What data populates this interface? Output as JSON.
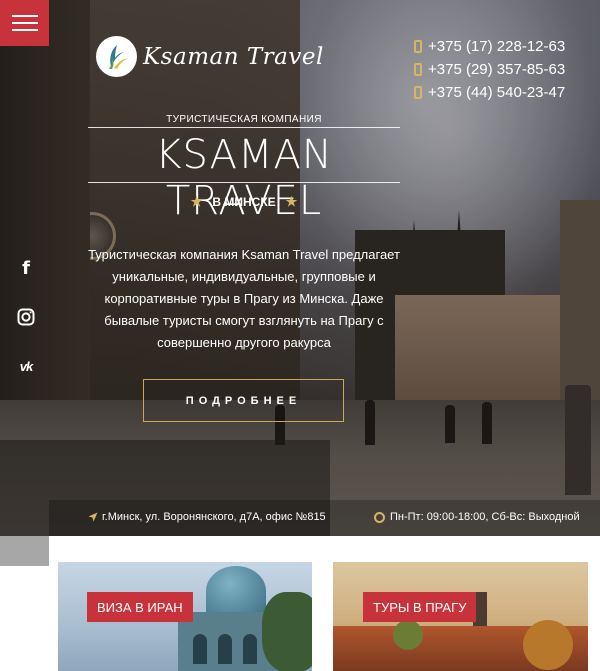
{
  "header": {
    "menu_icon": "hamburger-icon",
    "logo_text": "Ksaman Travel",
    "phones": [
      "+375 (17) 228-12-63",
      "+375 (29) 357-85-63",
      "+375 (44) 540-23-47"
    ]
  },
  "hero": {
    "subtitle": "ТУРИСТИЧЕСКАЯ КОМПАНИЯ",
    "title": "KSAMAN TRAVEL",
    "city": "В МИНСКЕ",
    "description": "Туристическая компания Ksaman Travel предлагает уникальные, индивидуальные, групповые и корпоративные туры в Прагу из Минска. Даже бывалые туристы смогут взглянуть на Прагу с совершенно другого ракурса",
    "more_button": "ПОДРОБНЕЕ"
  },
  "social": [
    {
      "name": "facebook",
      "glyph": "f"
    },
    {
      "name": "instagram",
      "glyph": "◎"
    },
    {
      "name": "vk",
      "glyph": "vk"
    }
  ],
  "footer_bar": {
    "address": "г.Минск, ул. Воронянского, д7А, офис №815",
    "hours": "Пн-Пт: 09:00-18:00, Сб-Вс: Выходной"
  },
  "cards": [
    {
      "label": "ВИЗА В ИРАН"
    },
    {
      "label": "ТУРЫ В ПРАГУ"
    }
  ],
  "colors": {
    "accent_red": "#c8323a",
    "accent_gold": "#d8b660",
    "grey_tab": "#a7a7a7"
  }
}
